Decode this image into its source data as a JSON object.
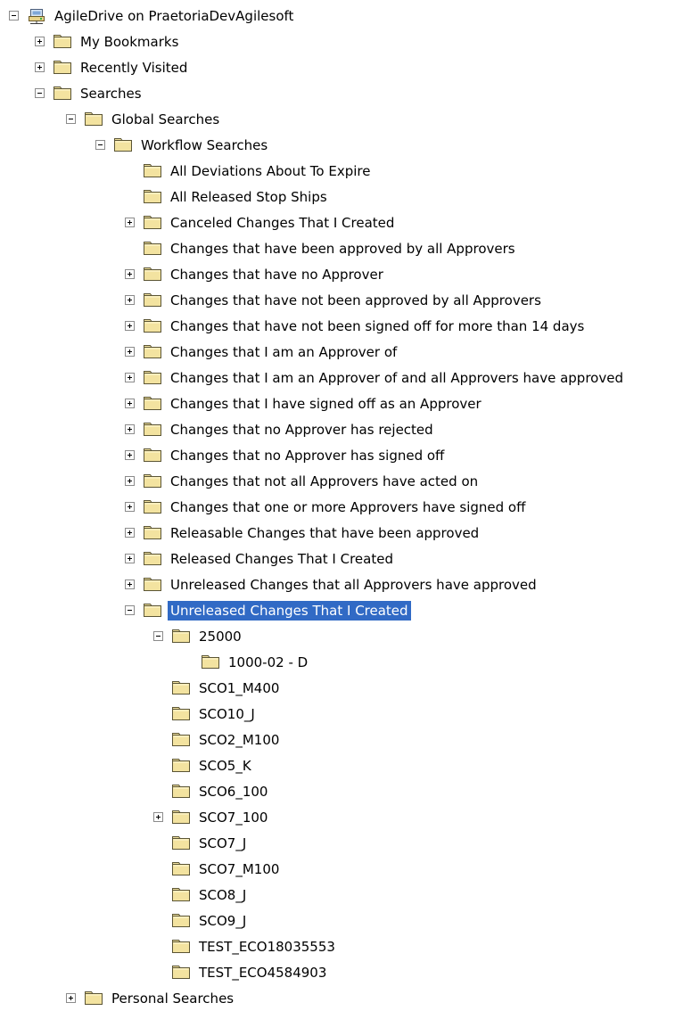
{
  "tree": {
    "root": {
      "label": "AgileDrive on PraetoriaDevAgilesoft",
      "expander": "minus",
      "icon": "network-drive-icon"
    },
    "items": [
      {
        "label": "My Bookmarks",
        "expander": "plus",
        "icon": "folder-icon"
      },
      {
        "label": "Recently Visited",
        "expander": "plus",
        "icon": "folder-icon"
      },
      {
        "label": "Searches",
        "expander": "minus",
        "icon": "folder-icon"
      },
      {
        "label": "Global Searches",
        "expander": "minus",
        "icon": "folder-icon"
      },
      {
        "label": "Workflow Searches",
        "expander": "minus",
        "icon": "folder-icon"
      },
      {
        "label": "All Deviations About To Expire",
        "expander": "none",
        "icon": "folder-icon"
      },
      {
        "label": "All Released Stop Ships",
        "expander": "none",
        "icon": "folder-icon"
      },
      {
        "label": "Canceled Changes That I Created",
        "expander": "plus",
        "icon": "folder-icon"
      },
      {
        "label": "Changes that have been approved by all Approvers",
        "expander": "none",
        "icon": "folder-icon"
      },
      {
        "label": "Changes that have no Approver",
        "expander": "plus",
        "icon": "folder-icon"
      },
      {
        "label": "Changes that have not been approved by all Approvers",
        "expander": "plus",
        "icon": "folder-icon"
      },
      {
        "label": "Changes that have not been signed off for more than 14 days",
        "expander": "plus",
        "icon": "folder-icon"
      },
      {
        "label": "Changes that I am an Approver of",
        "expander": "plus",
        "icon": "folder-icon"
      },
      {
        "label": "Changes that I am an Approver of and all Approvers have approved",
        "expander": "plus",
        "icon": "folder-icon"
      },
      {
        "label": "Changes that I have signed off as an Approver",
        "expander": "plus",
        "icon": "folder-icon"
      },
      {
        "label": "Changes that no Approver has rejected",
        "expander": "plus",
        "icon": "folder-icon"
      },
      {
        "label": "Changes that no Approver has signed off",
        "expander": "plus",
        "icon": "folder-icon"
      },
      {
        "label": "Changes that not all Approvers have acted on",
        "expander": "plus",
        "icon": "folder-icon"
      },
      {
        "label": "Changes that one or more Approvers have signed off",
        "expander": "plus",
        "icon": "folder-icon"
      },
      {
        "label": "Releasable Changes that have been approved",
        "expander": "plus",
        "icon": "folder-icon"
      },
      {
        "label": "Released Changes That I Created",
        "expander": "plus",
        "icon": "folder-icon"
      },
      {
        "label": "Unreleased Changes that all Approvers have approved",
        "expander": "plus",
        "icon": "folder-icon"
      },
      {
        "label": "Unreleased Changes That I Created",
        "expander": "minus",
        "icon": "folder-icon",
        "selected": true
      },
      {
        "label": "25000",
        "expander": "minus",
        "icon": "folder-icon"
      },
      {
        "label": "1000-02 - D",
        "expander": "none",
        "icon": "folder-icon"
      },
      {
        "label": "SCO1_M400",
        "expander": "none",
        "icon": "folder-icon"
      },
      {
        "label": "SCO10_J",
        "expander": "none",
        "icon": "folder-icon"
      },
      {
        "label": "SCO2_M100",
        "expander": "none",
        "icon": "folder-icon"
      },
      {
        "label": "SCO5_K",
        "expander": "none",
        "icon": "folder-icon"
      },
      {
        "label": "SCO6_100",
        "expander": "none",
        "icon": "folder-icon"
      },
      {
        "label": "SCO7_100",
        "expander": "plus",
        "icon": "folder-icon"
      },
      {
        "label": "SCO7_J",
        "expander": "none",
        "icon": "folder-icon"
      },
      {
        "label": "SCO7_M100",
        "expander": "none",
        "icon": "folder-icon"
      },
      {
        "label": "SCO8_J",
        "expander": "none",
        "icon": "folder-icon"
      },
      {
        "label": "SCO9_J",
        "expander": "none",
        "icon": "folder-icon"
      },
      {
        "label": "TEST_ECO18035553",
        "expander": "none",
        "icon": "folder-icon"
      },
      {
        "label": "TEST_ECO4584903",
        "expander": "none",
        "icon": "folder-icon"
      },
      {
        "label": "Personal Searches",
        "expander": "plus",
        "icon": "folder-icon"
      }
    ]
  },
  "colors": {
    "selection": "#316ac5",
    "selection_text": "#ffffff",
    "folder_fill": "#f3e3a0",
    "folder_border": "#5b5535"
  }
}
